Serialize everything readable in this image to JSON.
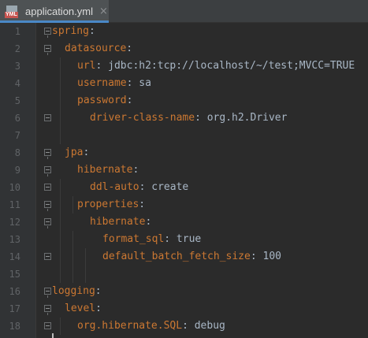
{
  "tab": {
    "title": "application.yml",
    "icon_label": "YML",
    "close": "×"
  },
  "colors": {
    "key": "#cc7832",
    "value": "#a9b7c6",
    "lineno": "#606366",
    "background": "#2b2b2b"
  },
  "lines": [
    {
      "num": "1",
      "key": "spring",
      "colon": ":",
      "value": ""
    },
    {
      "num": "2",
      "key": "datasource",
      "colon": ":",
      "value": ""
    },
    {
      "num": "3",
      "key": "url",
      "colon": ":",
      "value": " jdbc:h2:tcp://localhost/~/test;MVCC=TRUE"
    },
    {
      "num": "4",
      "key": "username",
      "colon": ":",
      "value": " sa"
    },
    {
      "num": "5",
      "key": "password",
      "colon": ":",
      "value": ""
    },
    {
      "num": "6",
      "key": "driver-class-name",
      "colon": ":",
      "value": " org.h2.Driver"
    },
    {
      "num": "7",
      "key": "",
      "colon": "",
      "value": ""
    },
    {
      "num": "8",
      "key": "jpa",
      "colon": ":",
      "value": ""
    },
    {
      "num": "9",
      "key": "hibernate",
      "colon": ":",
      "value": ""
    },
    {
      "num": "10",
      "key": "ddl-auto",
      "colon": ":",
      "value": " create"
    },
    {
      "num": "11",
      "key": "properties",
      "colon": ":",
      "value": ""
    },
    {
      "num": "12",
      "key": "hibernate",
      "colon": ":",
      "value": ""
    },
    {
      "num": "13",
      "key": "format_sql",
      "colon": ":",
      "value": " true"
    },
    {
      "num": "14",
      "key": "default_batch_fetch_size",
      "colon": ":",
      "value": " 100"
    },
    {
      "num": "15",
      "key": "",
      "colon": "",
      "value": ""
    },
    {
      "num": "16",
      "key": "logging",
      "colon": ":",
      "value": ""
    },
    {
      "num": "17",
      "key": "level",
      "colon": ":",
      "value": ""
    },
    {
      "num": "18",
      "key": "org.hibernate.SQL",
      "colon": ":",
      "value": " debug"
    }
  ]
}
